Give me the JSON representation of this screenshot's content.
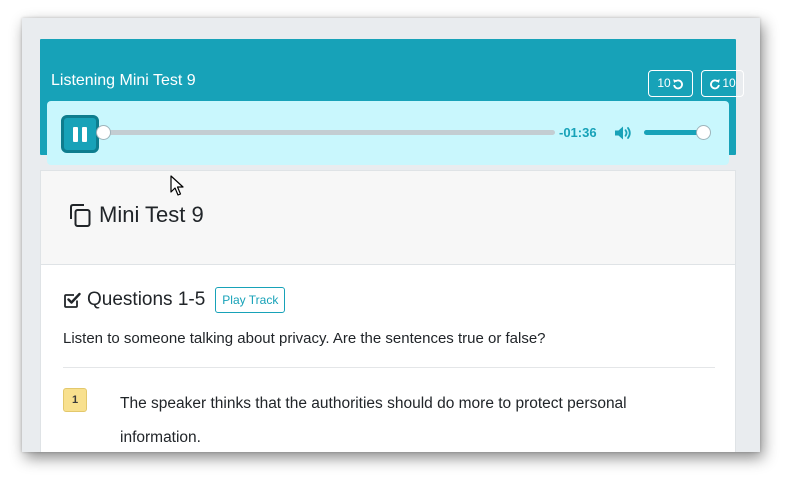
{
  "player": {
    "title": "Listening Mini Test 9",
    "skip_back_label": "10",
    "skip_forward_label": "10",
    "time_remaining": "-01:36",
    "progress_fraction": 0.008,
    "volume_fraction": 0.95,
    "state": "playing",
    "accent_color": "#17a2b8",
    "bar_background": "#c9f7fd"
  },
  "test": {
    "title": "Mini Test 9",
    "title_icon": "copy-icon"
  },
  "section": {
    "heading": "Questions 1-5",
    "heading_icon": "check-square-icon",
    "play_track_label": "Play Track",
    "instructions": "Listen to someone talking about privacy. Are the sentences true or false?"
  },
  "questions": [
    {
      "number": "1",
      "text": "The speaker thinks that the authorities should do more to protect personal information."
    }
  ]
}
